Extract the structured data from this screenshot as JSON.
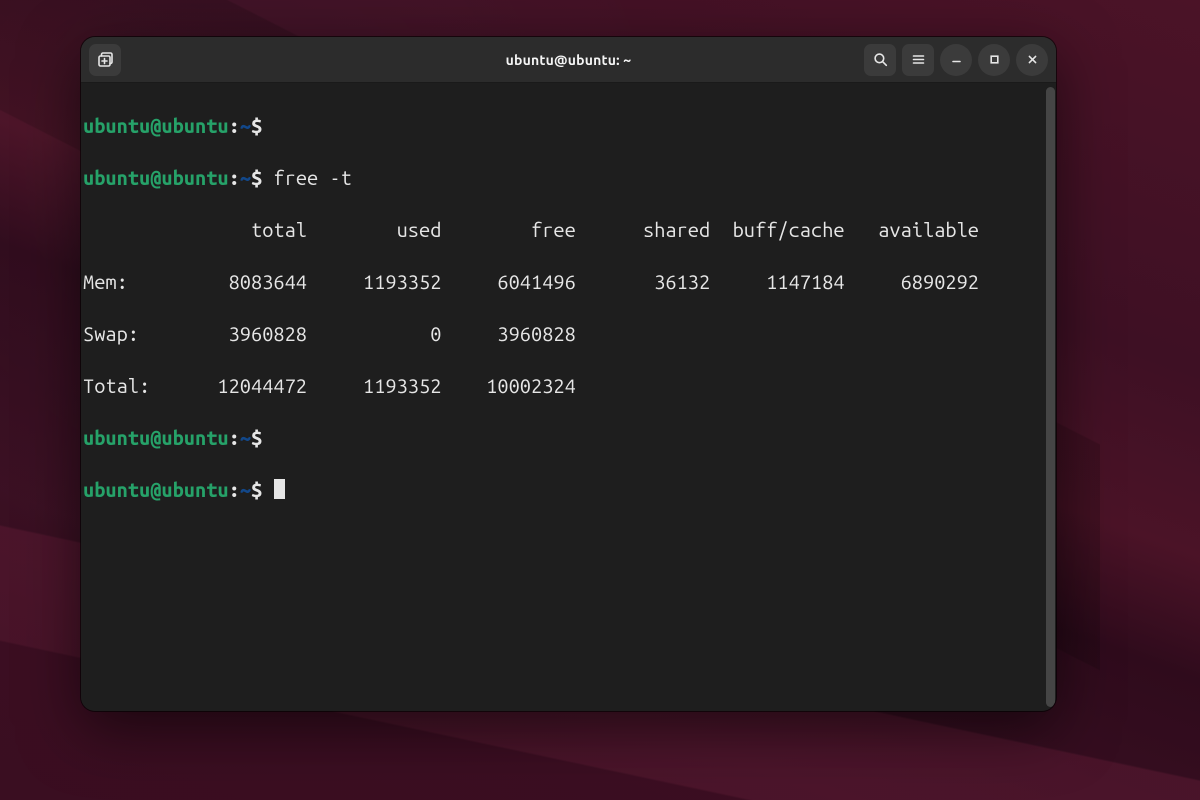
{
  "window": {
    "title": "ubuntu@ubuntu: ~"
  },
  "prompt": {
    "user_host": "ubuntu@ubuntu",
    "colon": ":",
    "path": "~",
    "sigil": "$"
  },
  "commands": {
    "l1_cmd": "",
    "l2_cmd": "free -t"
  },
  "free_output": {
    "header": "               total        used        free      shared  buff/cache   available",
    "mem_row": "Mem:         8083644     1193352     6041496       36132     1147184     6890292",
    "swap_row": "Swap:        3960828           0     3960828",
    "total_row": "Total:      12044472     1193352    10002324",
    "columns": [
      "total",
      "used",
      "free",
      "shared",
      "buff/cache",
      "available"
    ],
    "rows": [
      {
        "label": "Mem:",
        "total": 8083644,
        "used": 1193352,
        "free": 6041496,
        "shared": 36132,
        "buff_cache": 1147184,
        "available": 6890292
      },
      {
        "label": "Swap:",
        "total": 3960828,
        "used": 0,
        "free": 3960828
      },
      {
        "label": "Total:",
        "total": 12044472,
        "used": 1193352,
        "free": 10002324
      }
    ]
  },
  "colors": {
    "prompt_user": "#26a269",
    "prompt_path": "#12488b",
    "terminal_bg": "#1e1e1e",
    "terminal_fg": "#e6e6e6",
    "titlebar_bg": "#2c2c2c"
  }
}
